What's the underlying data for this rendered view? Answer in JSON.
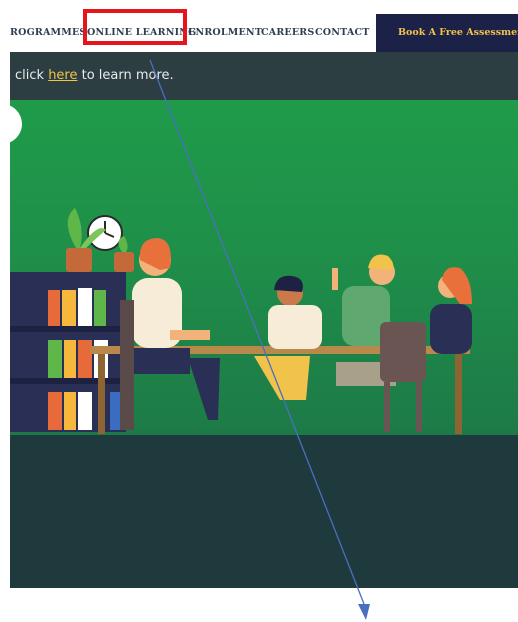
{
  "nav": {
    "items": [
      "ROGRAMMES",
      "ONLINE LEARNING",
      "ENROLMENT",
      "CAREERS",
      "CONTACT"
    ],
    "cta_label": "Book A Free Assessment"
  },
  "notice": {
    "before": "click ",
    "link": "here",
    "after": " to learn more."
  },
  "colors": {
    "nav_text": "#2f3e4f",
    "cta_bg": "#1c2147",
    "cta_text": "#f2c34b",
    "highlight": "#e5151b",
    "notice_bg": "#2c3e42",
    "hero_green": "#1f9b4a",
    "footer_dark": "#1e3a3d",
    "annotation_arrow": "#4a6fc1"
  },
  "hero": {
    "illustration": "people studying around a table with bookshelf, plants and clock",
    "icons": [
      "clock-icon",
      "plant-icon",
      "bookshelf-icon"
    ]
  }
}
